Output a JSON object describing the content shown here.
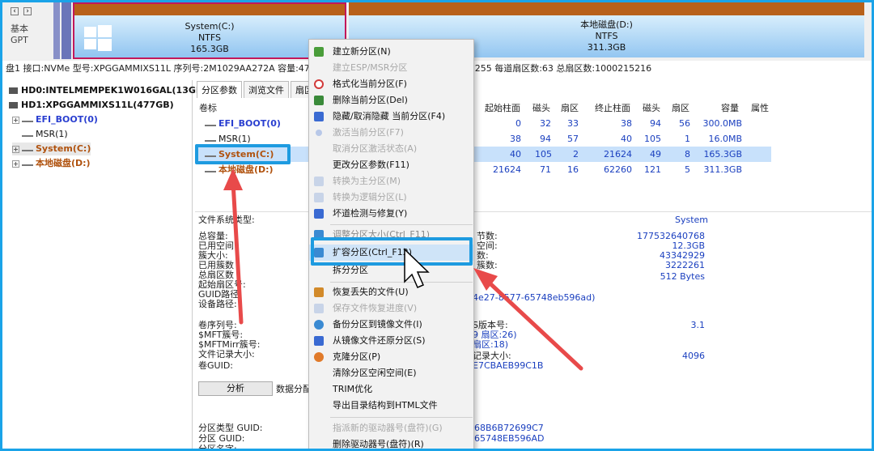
{
  "disk_map": {
    "label_line1": "基本",
    "label_line2": "GPT",
    "system_partition": {
      "name": "System(C:)",
      "fs": "NTFS",
      "size": "165.3GB"
    },
    "d_partition": {
      "name": "本地磁盘(D:)",
      "fs": "NTFS",
      "size": "311.3GB"
    }
  },
  "info_line": "盘1 接口:NVMe  型号:XPGGAMMIXS11L  序列号:2M1029AA272A  容量:47",
  "info_line_right": ":255  每道扇区数:63  总扇区数:1000215216",
  "tree": {
    "items": [
      {
        "label": "HD0:INTELMEMPEK1W016GAL(13GB)",
        "style": "disk"
      },
      {
        "label": "HD1:XPGGAMMIXS11L(477GB)",
        "style": "disk"
      },
      {
        "label": "EFI_BOOT(0)",
        "style": "part-blue"
      },
      {
        "label": "MSR(1)",
        "style": "part"
      },
      {
        "label": "System(C:)",
        "style": "part-sel"
      },
      {
        "label": "本地磁盘(D:)",
        "style": "part-orange"
      }
    ]
  },
  "tabs": [
    "分区参数",
    "浏览文件",
    "扇区编"
  ],
  "table": {
    "col_volume": "卷标",
    "headers": [
      "起始柱面",
      "磁头",
      "扇区",
      "终止柱面",
      "磁头",
      "扇区",
      "容量",
      "属性"
    ],
    "rows": [
      {
        "name": "EFI_BOOT(0)",
        "vals": [
          "0",
          "32",
          "33",
          "38",
          "94",
          "56",
          "300.0MB"
        ]
      },
      {
        "name": "MSR(1)",
        "vals": [
          "38",
          "94",
          "57",
          "40",
          "105",
          "1",
          "16.0MB"
        ]
      },
      {
        "name": "System(C:)",
        "vals": [
          "40",
          "105",
          "2",
          "21624",
          "49",
          "8",
          "165.3GB"
        ]
      },
      {
        "name": "本地磁盘(D:)",
        "vals": [
          "21624",
          "71",
          "16",
          "62260",
          "121",
          "5",
          "311.3GB"
        ]
      }
    ]
  },
  "details": {
    "fs_type_label": "文件系统类型:",
    "fs_type_value": "System",
    "left_labels1": [
      "总容量:",
      "已用空间",
      "簇大小:",
      "已用簇数",
      "总扇区数",
      "起始扇区号:",
      "GUID路径:",
      "设备路径:"
    ],
    "right_labels1": [
      "节数:",
      "空间:",
      "数:",
      "簇数:",
      "",
      "",
      "4e27-8577-65748eb596ad)"
    ],
    "right_values1": [
      "177532640768",
      "12.3GB",
      "43342929",
      "3222261",
      "512 Bytes"
    ],
    "left_labels2": [
      "卷序列号:",
      "$MFT簇号:",
      "$MFTMirr簇号:",
      "文件记录大小:",
      "卷GUID:"
    ],
    "right_labels2": [
      "S版本号:",
      "9 扇区:26)",
      "扇区:18)",
      "记录大小:",
      "E7CBAEB99C1B"
    ],
    "right_values2": [
      "3.1",
      "4096"
    ],
    "analyze_button": "分析",
    "data_dist_label": "数据分配",
    "left_labels3": [
      "分区类型 GUID:",
      "分区 GUID:",
      "分区名字:"
    ],
    "right_labels3": [
      "68B6B72699C7",
      "65748EB596AD"
    ]
  },
  "context_menu": {
    "items": [
      {
        "label": "建立新分区(N)",
        "disabled": false,
        "icon_color": "#4a9d3a"
      },
      {
        "label": "建立ESP/MSR分区",
        "disabled": true,
        "icon_color": ""
      },
      {
        "label": "格式化当前分区(F)",
        "disabled": false,
        "icon_color": "#d23a3a"
      },
      {
        "label": "删除当前分区(Del)",
        "disabled": false,
        "icon_color": "#3a8a3a"
      },
      {
        "label": "隐藏/取消隐藏 当前分区(F4)",
        "disabled": false,
        "icon_color": "#3a6ad2"
      },
      {
        "label": "激活当前分区(F7)",
        "disabled": true,
        "icon_color": "#b8c8e8"
      },
      {
        "label": "取消分区激活状态(A)",
        "disabled": true,
        "icon_color": ""
      },
      {
        "label": "更改分区参数(F11)",
        "disabled": false,
        "icon_color": ""
      },
      {
        "label": "转换为主分区(M)",
        "disabled": true,
        "icon_color": "#c8d4e8"
      },
      {
        "label": "转换为逻辑分区(L)",
        "disabled": true,
        "icon_color": "#c8d4e8"
      },
      {
        "label": "坏道检测与修复(Y)",
        "disabled": false,
        "icon_color": "#3a6ad2"
      },
      {
        "label": "调整分区大小(Ctrl_F11)",
        "disabled": false,
        "icon_color": "#3a8ad2"
      },
      {
        "label": "扩容分区(Ctrl_F12)",
        "disabled": false,
        "icon_color": "#3a8ad2"
      },
      {
        "label": "拆分分区",
        "disabled": false,
        "icon_color": ""
      },
      {
        "label": "恢复丢失的文件(U)",
        "disabled": false,
        "icon_color": "#d28a2a"
      },
      {
        "label": "保存文件恢复进度(V)",
        "disabled": true,
        "icon_color": "#c8d4e8"
      },
      {
        "label": "备份分区到镜像文件(I)",
        "disabled": false,
        "icon_color": "#3a8ad2"
      },
      {
        "label": "从镜像文件还原分区(S)",
        "disabled": false,
        "icon_color": "#3a6ad2"
      },
      {
        "label": "克隆分区(P)",
        "disabled": false,
        "icon_color": "#e07a2a"
      },
      {
        "label": "清除分区空闲空间(E)",
        "disabled": false,
        "icon_color": ""
      },
      {
        "label": "TRIM优化",
        "disabled": false,
        "icon_color": ""
      },
      {
        "label": "导出目录结构到HTML文件",
        "disabled": false,
        "icon_color": ""
      },
      {
        "label": "指派新的驱动器号(盘符)(G)",
        "disabled": true,
        "icon_color": ""
      },
      {
        "label": "删除驱动器号(盘符)(R)",
        "disabled": false,
        "icon_color": ""
      }
    ]
  },
  "colors": {
    "highlight_box": "#1e9be0",
    "arrow": "#e84a4a",
    "selected_row": "#c8e1fb"
  }
}
